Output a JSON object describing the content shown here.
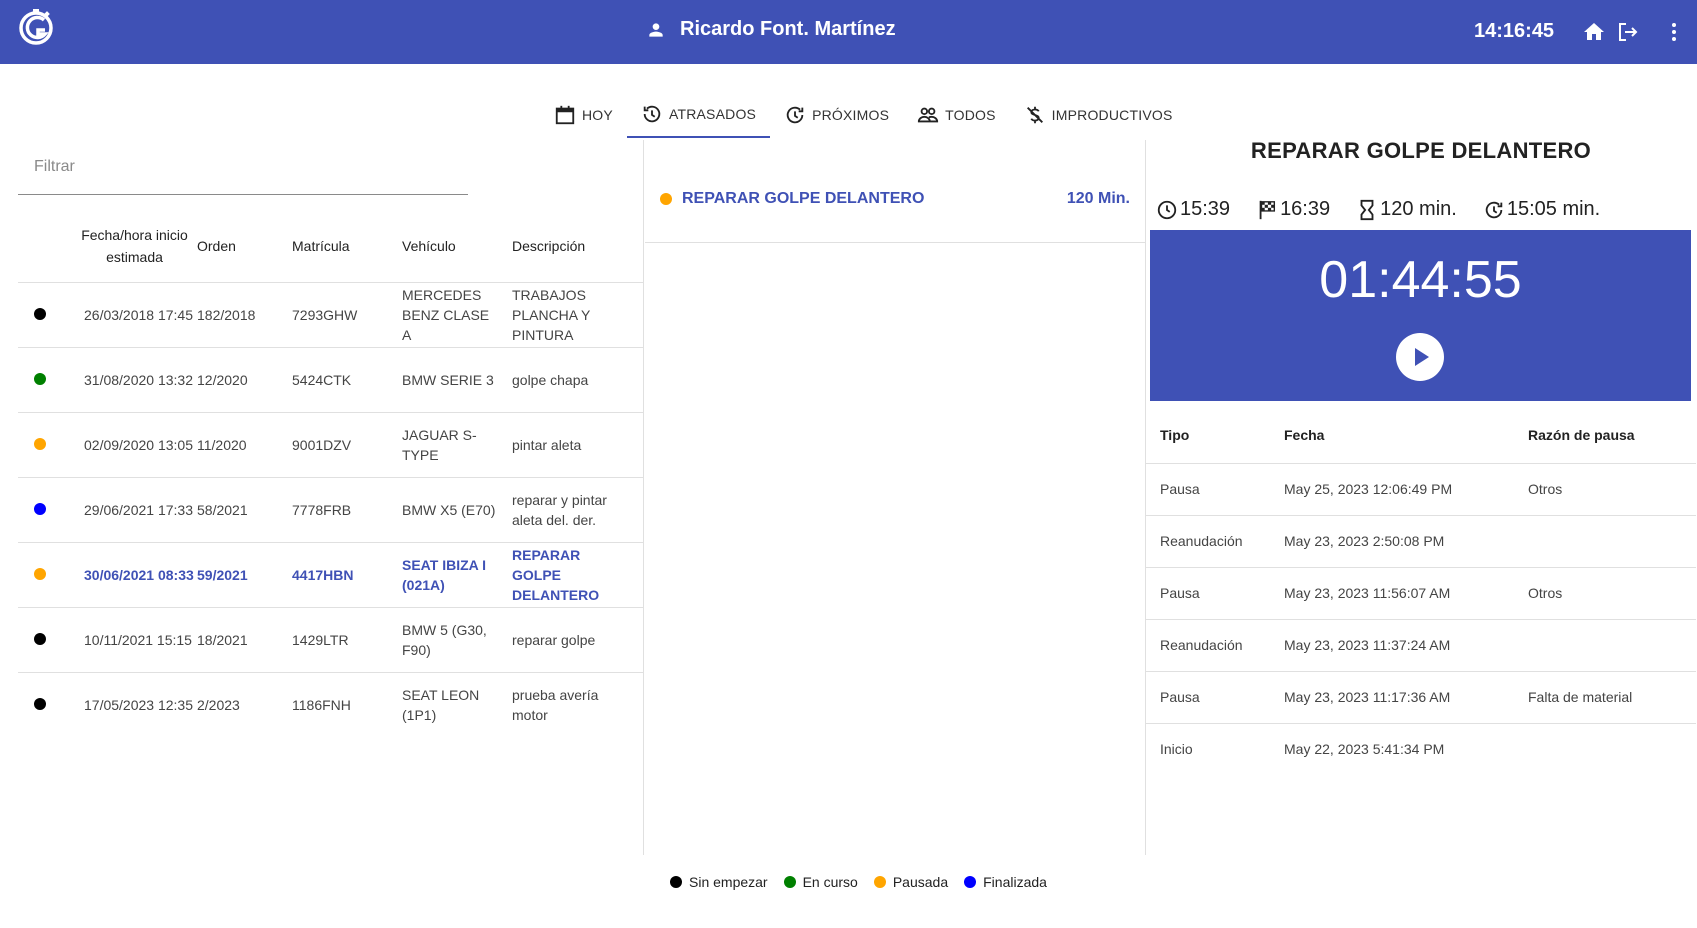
{
  "header": {
    "user_name": "Ricardo Font. Martínez",
    "time": "14:16:45"
  },
  "tabs": [
    {
      "label": "HOY",
      "icon": "calendar-icon",
      "active": false
    },
    {
      "label": "ATRASADOS",
      "icon": "history-icon",
      "active": true
    },
    {
      "label": "PRÓXIMOS",
      "icon": "update-icon",
      "active": false
    },
    {
      "label": "TODOS",
      "icon": "people-icon",
      "active": false
    },
    {
      "label": "IMPRODUCTIVOS",
      "icon": "money-off-icon",
      "active": false
    }
  ],
  "filter": {
    "placeholder": "Filtrar"
  },
  "orders": {
    "columns": {
      "date": "Fecha/hora inicio estimada",
      "order": "Orden",
      "plate": "Matrícula",
      "vehicle": "Vehículo",
      "description": "Descripción"
    },
    "rows": [
      {
        "status": "Sin empezar",
        "color": "#000000",
        "date": "26/03/2018 17:45",
        "order": "182/2018",
        "plate": "7293GHW",
        "vehicle": "MERCEDES BENZ CLASE A",
        "description": "TRABAJOS PLANCHA Y PINTURA"
      },
      {
        "status": "En curso",
        "color": "#008000",
        "date": "31/08/2020 13:32",
        "order": "12/2020",
        "plate": "5424CTK",
        "vehicle": "BMW SERIE 3",
        "description": "golpe chapa"
      },
      {
        "status": "Pausada",
        "color": "#ffa500",
        "date": "02/09/2020 13:05",
        "order": "11/2020",
        "plate": "9001DZV",
        "vehicle": "JAGUAR S-TYPE",
        "description": "pintar aleta"
      },
      {
        "status": "Finalizada",
        "color": "#0000ff",
        "date": "29/06/2021 17:33",
        "order": "58/2021",
        "plate": "7778FRB",
        "vehicle": "BMW X5 (E70)",
        "description": "reparar y pintar aleta del. der."
      },
      {
        "status": "Pausada",
        "color": "#ffa500",
        "date": "30/06/2021 08:33",
        "order": "59/2021",
        "plate": "4417HBN",
        "vehicle": "SEAT IBIZA I (021A)",
        "description": "REPARAR GOLPE DELANTERO",
        "selected": true
      },
      {
        "status": "Sin empezar",
        "color": "#000000",
        "date": "10/11/2021 15:15",
        "order": "18/2021",
        "plate": "1429LTR",
        "vehicle": "BMW 5 (G30, F90)",
        "description": "reparar golpe"
      },
      {
        "status": "Sin empezar",
        "color": "#000000",
        "date": "17/05/2023 12:35",
        "order": "2/2023",
        "plate": "1186FNH",
        "vehicle": "SEAT LEON (1P1)",
        "description": "prueba avería motor"
      }
    ]
  },
  "task": {
    "name": "REPARAR GOLPE DELANTERO",
    "duration": "120 Min.",
    "color": "#ffa500"
  },
  "detail": {
    "title": "REPARAR GOLPE DELANTERO",
    "start": "15:39",
    "end": "16:39",
    "estimated": "120 min.",
    "elapsed": "15:05 min.",
    "timer": "01:44:55"
  },
  "log": {
    "columns": {
      "type": "Tipo",
      "date": "Fecha",
      "reason": "Razón de pausa"
    },
    "rows": [
      {
        "type": "Pausa",
        "date": "May 25, 2023 12:06:49 PM",
        "reason": "Otros"
      },
      {
        "type": "Reanudación",
        "date": "May 23, 2023 2:50:08 PM",
        "reason": ""
      },
      {
        "type": "Pausa",
        "date": "May 23, 2023 11:56:07 AM",
        "reason": "Otros"
      },
      {
        "type": "Reanudación",
        "date": "May 23, 2023 11:37:24 AM",
        "reason": ""
      },
      {
        "type": "Pausa",
        "date": "May 23, 2023 11:17:36 AM",
        "reason": "Falta de material"
      },
      {
        "type": "Inicio",
        "date": "May 22, 2023 5:41:34 PM",
        "reason": ""
      }
    ]
  },
  "legend": [
    {
      "label": "Sin empezar",
      "color": "#000000"
    },
    {
      "label": "En curso",
      "color": "#008000"
    },
    {
      "label": "Pausada",
      "color": "#ffa500"
    },
    {
      "label": "Finalizada",
      "color": "#0000ff"
    }
  ],
  "colors": {
    "primary": "#3f51b5"
  }
}
